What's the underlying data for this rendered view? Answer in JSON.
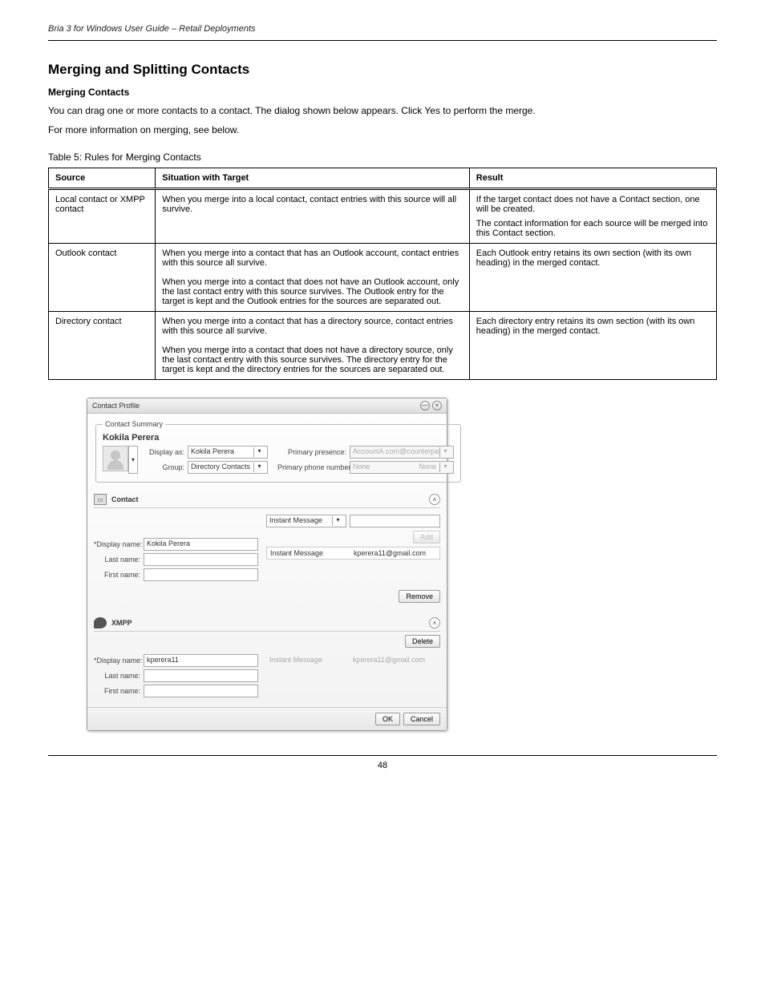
{
  "page": {
    "header_left": "Bria 3 for Windows User Guide – Retail Deployments",
    "header_right": "",
    "footer": "48"
  },
  "section": {
    "title": "Merging and Splitting Contacts",
    "merge_heading": "Merging Contacts",
    "merge_p1": "You can drag one or more contacts to a contact. The dialog shown below appears. Click Yes to perform the merge.",
    "merge_p2": "For more information on merging, see below.",
    "table_title": "Table 5: Rules for Merging Contacts"
  },
  "table": {
    "headers": [
      "Source",
      "Situation with Target",
      "Result"
    ],
    "rows": [
      {
        "source": "Local contact or XMPP contact",
        "situation": "When you merge into a local contact, contact entries with this source will all survive.",
        "result_lines": [
          "If the target contact does not have a Contact section, one will be created.",
          "The contact information for each source will be merged into this Contact section."
        ]
      },
      {
        "source": "Outlook contact",
        "situation": "When you merge into a contact that has an Outlook account, contact entries with this source all survive.\n\nWhen you merge into a contact that does not have an Outlook account, only the last contact entry with this source survives. The Outlook entry for the target is kept and the Outlook entries for the sources are separated out.",
        "result": "Each Outlook entry retains its own section (with its own heading) in the merged contact."
      },
      {
        "source": "Directory contact",
        "situation": "When you merge into a contact that has a directory source, contact entries with this source all survive.\n\nWhen you merge into a contact that does not have a directory source, only the last contact entry with this source survives. The directory entry for the target is kept and the directory entries for the sources are separated out.",
        "result": "Each directory entry retains its own section (with its own heading) in the merged contact."
      }
    ]
  },
  "dialog": {
    "title": "Contact Profile",
    "minimize_tip": "—",
    "close_tip": "×",
    "summary_legend": "Contact Summary",
    "contact_name": "Kokila Perera",
    "display_as_label": "Display as:",
    "display_as_value": "Kokila Perera",
    "group_label": "Group:",
    "group_value": "Directory Contacts",
    "primary_presence_label": "Primary presence:",
    "primary_presence_value": "AccountA.com@counterpath.co",
    "primary_phone_label": "Primary phone number:",
    "primary_phone_left": "None",
    "primary_phone_right": "None",
    "sections": [
      {
        "icon": "card",
        "heading": "Contact",
        "display_name_label": "*Display name:",
        "display_name_value": "Kokila Perera",
        "last_name_label": "Last name:",
        "last_name_value": "",
        "first_name_label": "First name:",
        "first_name_value": "",
        "method_selector": "Instant Message",
        "method_value": "",
        "add_btn": "Add",
        "listing_method": "Instant Message",
        "listing_value": "kperera11@gmail.com",
        "remove_btn": "Remove"
      },
      {
        "icon": "bubble",
        "heading": "XMPP",
        "delete_btn": "Delete",
        "display_name_label": "*Display name:",
        "display_name_value": "kperera11",
        "last_name_label": "Last name:",
        "last_name_value": "",
        "first_name_label": "First name:",
        "first_name_value": "",
        "listing_method": "Instant Message",
        "listing_value": "kperera11@gmail.com"
      }
    ],
    "ok_btn": "OK",
    "cancel_btn": "Cancel"
  }
}
